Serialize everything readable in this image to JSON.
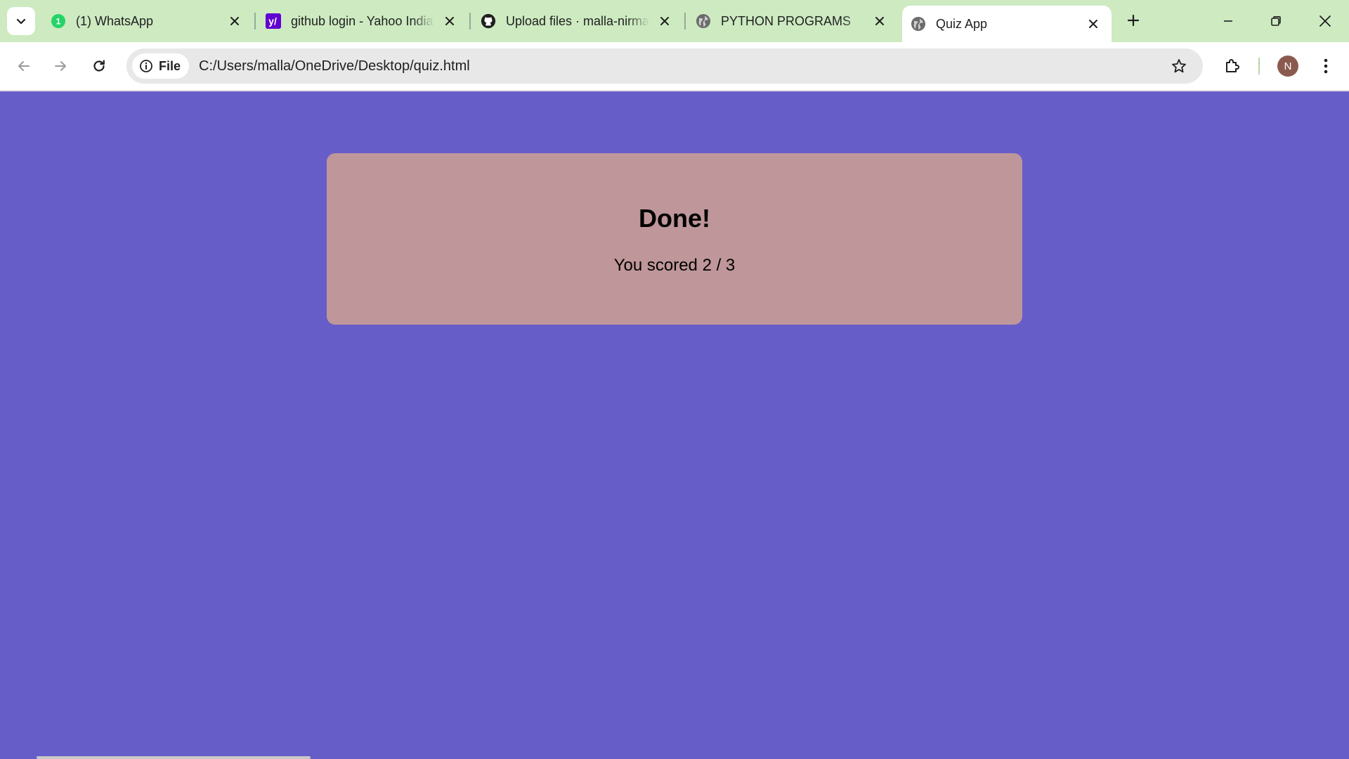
{
  "browser": {
    "tabs": [
      {
        "title": "(1) WhatsApp",
        "favicon": "whatsapp-icon",
        "badge": "1",
        "active": false
      },
      {
        "title": "github login - Yahoo India Search",
        "favicon": "yahoo-icon",
        "active": false
      },
      {
        "title": "Upload files · malla-nirmala",
        "favicon": "github-icon",
        "active": false
      },
      {
        "title": "PYTHON PROGRAMS",
        "favicon": "globe-icon",
        "active": false
      },
      {
        "title": "Quiz App",
        "favicon": "globe-icon",
        "active": true
      }
    ],
    "address_bar": {
      "chip_label": "File",
      "url": "C:/Users/malla/OneDrive/Desktop/quiz.html"
    },
    "profile_initial": "N",
    "colors": {
      "tabstrip": "#cdeac1",
      "page_background": "#665dc9",
      "avatar": "#8b5a4f"
    }
  },
  "quiz": {
    "title": "Done!",
    "result": "You scored 2 / 3",
    "score": 2,
    "total": 3,
    "card_color": "#bf9699"
  }
}
